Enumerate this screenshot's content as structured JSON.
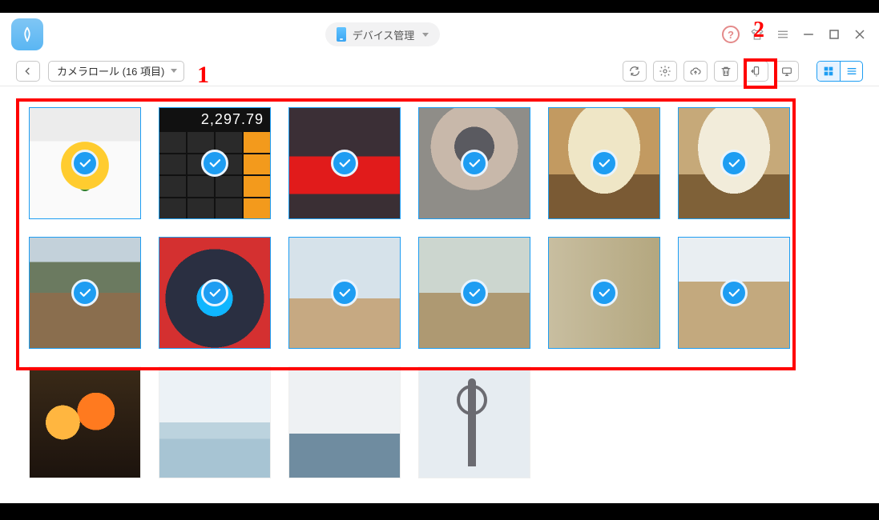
{
  "colors": {
    "accent": "#1e9df2",
    "mark": "#ff0000"
  },
  "titlebar": {
    "device_label": "デバイス管理",
    "actions": {
      "help": "?",
      "skin": "skin",
      "menu": "menu",
      "minimize": "minimize",
      "maximize": "maximize",
      "close": "close"
    }
  },
  "toolbar": {
    "back": "Back",
    "album_selector": "カメラロール (16 項目)",
    "buttons": {
      "refresh": "Refresh",
      "settings": "Settings",
      "to_cloud": "To Cloud",
      "delete": "Delete",
      "to_device": "To Device",
      "to_pc": "To PC"
    },
    "view": {
      "grid": "Grid view",
      "list": "List view",
      "active": "grid"
    }
  },
  "tutorial": {
    "step1": "1",
    "step2": "2"
  },
  "calculator_display": "2,297.79",
  "selected_count": 12,
  "photos": [
    {
      "id": "sunflower",
      "selected": true,
      "alt": "Sunflower photo"
    },
    {
      "id": "calculator",
      "selected": true,
      "alt": "Calculator screenshot"
    },
    {
      "id": "cocacola",
      "selected": true,
      "alt": "Coca-Cola sign"
    },
    {
      "id": "person1",
      "selected": true,
      "alt": "Person making V sign"
    },
    {
      "id": "mirror1",
      "selected": true,
      "alt": "Round mirror in a shop"
    },
    {
      "id": "mirror2",
      "selected": true,
      "alt": "Round mirror in a shop 2"
    },
    {
      "id": "deer1",
      "selected": true,
      "alt": "Deer in park"
    },
    {
      "id": "blur",
      "selected": true,
      "alt": "Blurry red building"
    },
    {
      "id": "selfie",
      "selected": true,
      "alt": "Group selfie with deer"
    },
    {
      "id": "feeding",
      "selected": true,
      "alt": "Feeding a deer"
    },
    {
      "id": "market",
      "selected": true,
      "alt": "Crowded market"
    },
    {
      "id": "deer2",
      "selected": true,
      "alt": "Two deer"
    },
    {
      "id": "bbq",
      "selected": false,
      "alt": "Barbecue skewers"
    },
    {
      "id": "lake",
      "selected": false,
      "alt": "Lake and mountains"
    },
    {
      "id": "ferry",
      "selected": false,
      "alt": "Ferry on water"
    },
    {
      "id": "tower",
      "selected": false,
      "alt": "TV tower"
    }
  ]
}
